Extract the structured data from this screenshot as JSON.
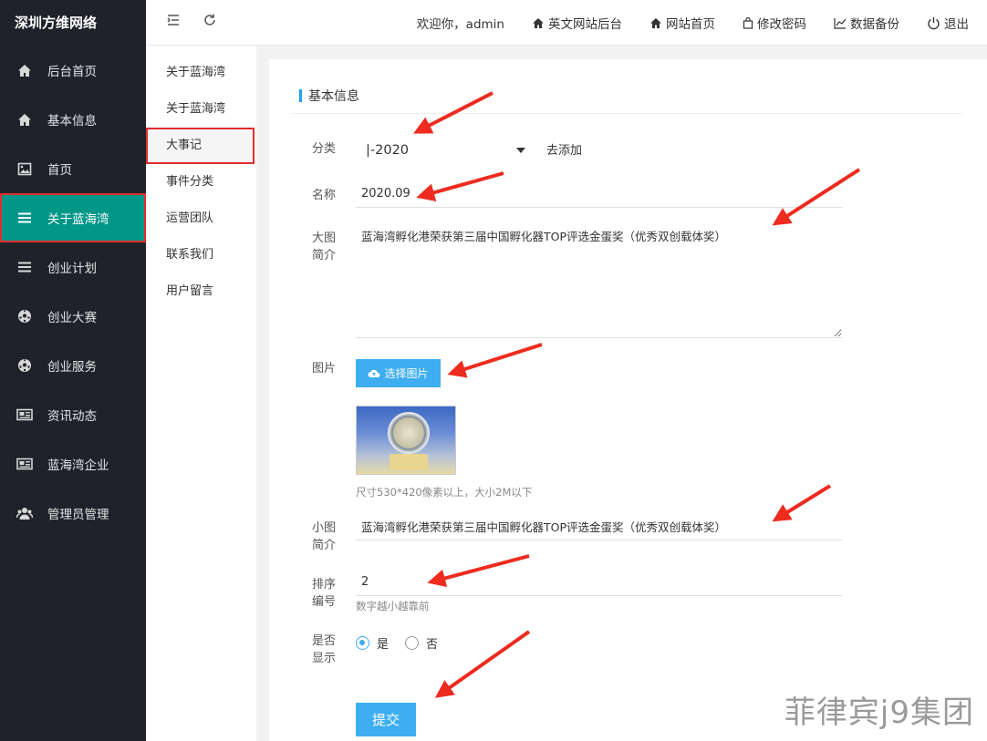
{
  "brand": "深圳方维网络",
  "sidebar": {
    "items": [
      {
        "label": "后台首页",
        "icon": "home-icon"
      },
      {
        "label": "基本信息",
        "icon": "home-icon"
      },
      {
        "label": "首页",
        "icon": "image-icon"
      },
      {
        "label": "关于蓝海湾",
        "icon": "list-icon",
        "active": true
      },
      {
        "label": "创业计划",
        "icon": "list-icon"
      },
      {
        "label": "创业大赛",
        "icon": "soccer-ball-icon"
      },
      {
        "label": "创业服务",
        "icon": "soccer-ball-icon"
      },
      {
        "label": "资讯动态",
        "icon": "newspaper-icon"
      },
      {
        "label": "蓝海湾企业",
        "icon": "newspaper-icon"
      },
      {
        "label": "管理员管理",
        "icon": "users-icon"
      }
    ]
  },
  "header": {
    "welcome": "欢迎你，admin",
    "links": [
      {
        "label": "英文网站后台",
        "icon": "home-icon"
      },
      {
        "label": "网站首页",
        "icon": "home-icon"
      },
      {
        "label": "修改密码",
        "icon": "bag-icon"
      },
      {
        "label": "数据备份",
        "icon": "chart-icon"
      },
      {
        "label": "退出",
        "icon": "power-icon"
      }
    ]
  },
  "submenu": {
    "items": [
      {
        "label": "关于蓝海湾"
      },
      {
        "label": "关于蓝海湾"
      },
      {
        "label": "大事记",
        "active": true
      },
      {
        "label": "事件分类"
      },
      {
        "label": "运营团队"
      },
      {
        "label": "联系我们"
      },
      {
        "label": "用户留言"
      }
    ]
  },
  "form": {
    "section_title": "基本信息",
    "category_label": "分类",
    "category_value": "|-2020",
    "add_link": "去添加",
    "name_label": "名称",
    "name_value": "2020.09",
    "big_intro_label_1": "大图",
    "big_intro_label_2": "简介",
    "big_intro_value": "蓝海湾孵化港荣获第三届中国孵化器TOP评选金蛋奖（优秀双创载体奖）",
    "image_label": "图片",
    "upload_button": "选择图片",
    "image_hint": "尺寸530*420像素以上，大小2M以下",
    "small_intro_label_1": "小图",
    "small_intro_label_2": "简介",
    "small_intro_value": "蓝海湾孵化港荣获第三届中国孵化器TOP评选金蛋奖（优秀双创载体奖）",
    "sort_label_1": "排序",
    "sort_label_2": "编号",
    "sort_value": "2",
    "sort_hint": "数字越小越靠前",
    "show_label_1": "是否",
    "show_label_2": "显示",
    "show_yes": "是",
    "show_no": "否",
    "show_selected": "是",
    "submit_button": "提交"
  },
  "annotation_color": "#ee2b1f",
  "watermark": "菲律宾j9集团"
}
